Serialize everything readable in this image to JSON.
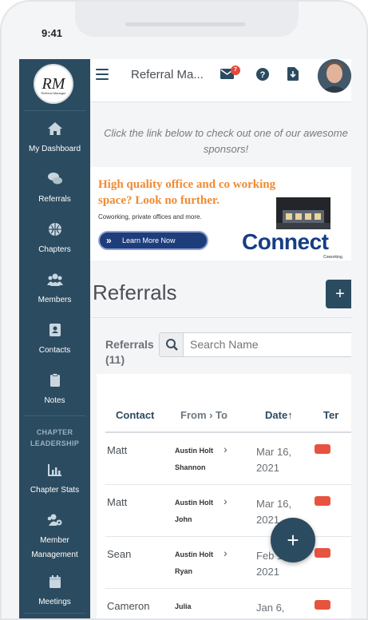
{
  "status": {
    "time": "9:41"
  },
  "sidebar": {
    "logo_text": "RM",
    "logo_sub": "Referral Manager",
    "items": [
      {
        "label": "My Dashboard",
        "icon": "home-icon"
      },
      {
        "label": "Referrals",
        "icon": "referrals-icon"
      },
      {
        "label": "Chapters",
        "icon": "globe-icon"
      },
      {
        "label": "Members",
        "icon": "users-icon"
      },
      {
        "label": "Contacts",
        "icon": "contact-card-icon"
      },
      {
        "label": "Notes",
        "icon": "clipboard-icon"
      }
    ],
    "section_title": "CHAPTER LEADERSHIP",
    "leadership_items": [
      {
        "label": "Chapter Stats",
        "icon": "bar-chart-icon"
      },
      {
        "label": "Member Management",
        "icon": "users-cog-icon"
      },
      {
        "label": "Meetings",
        "icon": "calendar-icon"
      }
    ]
  },
  "topbar": {
    "page_name": "Referral Ma...",
    "mail_badge": "7"
  },
  "sponsor": {
    "text": "Click the link below to check out one of our awesome sponsors!",
    "headline": "High quality office and co working space? Look no further.",
    "sub": "Coworking, private offices and more.",
    "button": "Learn More Now",
    "logo": "Connect",
    "logo_sub": "Coworking."
  },
  "main": {
    "heading": "Referrals",
    "add_label": "+",
    "list_title": "Referrals (11)",
    "search_placeholder": "Search Name",
    "columns": [
      "Contact",
      "From › To",
      "Date↑",
      "Ter"
    ],
    "rows": [
      {
        "contact": "Matt",
        "from": "Austin Holt",
        "to": "Shannon",
        "date": "Mar 16, 2021"
      },
      {
        "contact": "Matt",
        "from": "Austin Holt",
        "to": "John",
        "date": "Mar 16, 2021"
      },
      {
        "contact": "Sean",
        "from": "Austin Holt",
        "to": "Ryan",
        "date": "Feb 11, 2021"
      },
      {
        "contact": "Cameron",
        "from": "Julia",
        "to": "",
        "date": "Jan 6,"
      }
    ]
  },
  "colors": {
    "sidebar": "#2b4b60",
    "accent": "#e8533f",
    "ad_orange": "#f08a32",
    "ad_blue": "#1e3d7b"
  }
}
